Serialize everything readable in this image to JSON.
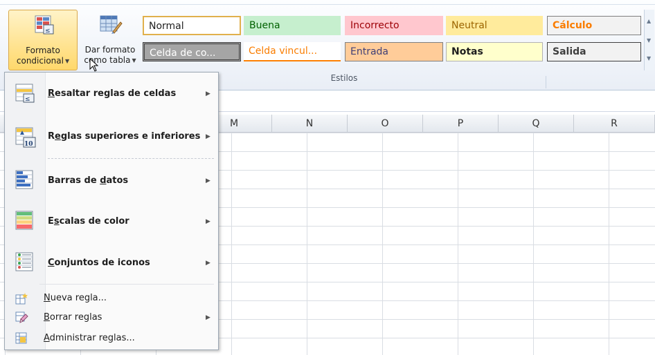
{
  "ribbon": {
    "conditional_format": {
      "line1": "Formato",
      "line2": "condicional"
    },
    "format_as_table": {
      "line1": "Dar formato",
      "line2": "como tabla"
    },
    "styles_group_label": "Estilos",
    "styles": [
      {
        "label": "Normal",
        "bg": "#ffffff",
        "color": "#1e1e1e",
        "border": "#e0b04c"
      },
      {
        "label": "Buena",
        "bg": "#c6efce",
        "color": "#006100",
        "border": "#c6efce"
      },
      {
        "label": "Incorrecto",
        "bg": "#ffc7ce",
        "color": "#9c0006",
        "border": "#ffc7ce"
      },
      {
        "label": "Neutral",
        "bg": "#ffeb9c",
        "color": "#9c6500",
        "border": "#ffeb9c"
      },
      {
        "label": "Cálculo",
        "bg": "#f2f2f2",
        "color": "#fa7d00",
        "border": "#7f7f7f"
      },
      {
        "label": "Celda de co...",
        "bg": "#a5a5a5",
        "color": "#ffffff",
        "border": "#3f3f3f"
      },
      {
        "label": "Celda vincul...",
        "bg": "#ffffff",
        "color": "#fa7d00",
        "border": "#ff8001"
      },
      {
        "label": "Entrada",
        "bg": "#ffcc99",
        "color": "#3f3f76",
        "border": "#7f7f7f"
      },
      {
        "label": "Notas",
        "bg": "#ffffcc",
        "color": "#1e1e1e",
        "border": "#b2b2b2"
      },
      {
        "label": "Salida",
        "bg": "#f2f2f2",
        "color": "#3f3f3f",
        "border": "#3f3f3f"
      }
    ]
  },
  "columns": [
    "M",
    "N",
    "O",
    "P",
    "Q",
    "R"
  ],
  "menu": {
    "items": [
      {
        "pre": "",
        "acc": "R",
        "post": "esaltar reglas de celdas",
        "icon": "highlight-cells-rules-icon"
      },
      {
        "pre": "R",
        "acc": "e",
        "post": "glas superiores e inferiores",
        "icon": "top-bottom-rules-icon"
      },
      {
        "pre": "Barras de ",
        "acc": "d",
        "post": "atos",
        "icon": "data-bars-icon"
      },
      {
        "pre": "E",
        "acc": "s",
        "post": "calas de color",
        "icon": "color-scales-icon"
      },
      {
        "pre": "",
        "acc": "C",
        "post": "onjuntos de iconos",
        "icon": "icon-sets-icon"
      }
    ],
    "small_items": [
      {
        "pre": "",
        "acc": "N",
        "post": "ueva regla...",
        "icon": "new-rule-icon"
      },
      {
        "pre": "",
        "acc": "B",
        "post": "orrar reglas",
        "icon": "clear-rules-icon"
      },
      {
        "pre": "",
        "acc": "A",
        "post": "dministrar reglas...",
        "icon": "manage-rules-icon"
      }
    ]
  }
}
